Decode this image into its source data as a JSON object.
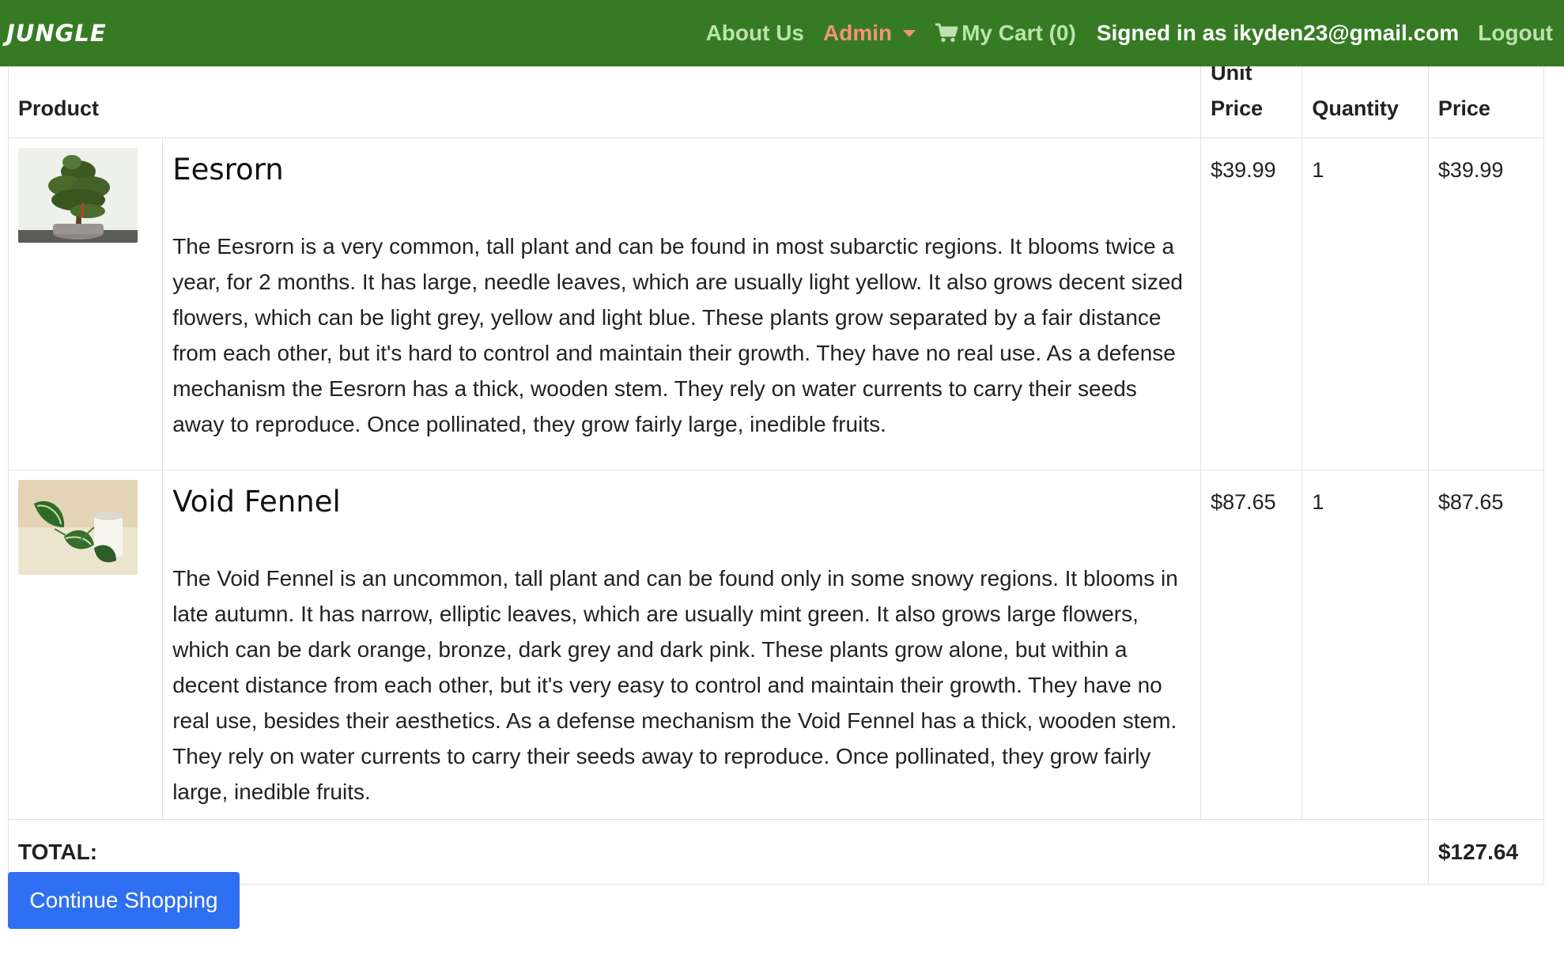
{
  "navbar": {
    "brand": "JUNGLE",
    "about": "About Us",
    "admin": "Admin",
    "cart": "My Cart (0)",
    "signed_in": "Signed in as ikyden23@gmail.com",
    "logout": "Logout",
    "colors": {
      "bg": "#367b24",
      "link": "#bde2ad",
      "admin": "#f59279"
    }
  },
  "table": {
    "headers": {
      "product": "Product",
      "unit_price": "Unit Price",
      "unit_price_top": "Unit",
      "unit_price_bottom": "Price",
      "quantity": "Quantity",
      "price": "Price"
    },
    "rows": [
      {
        "name": "Eesrorn",
        "image": "bonsai-tree",
        "description": "The Eesrorn is a very common, tall plant and can be found in most subarctic regions. It blooms twice a year, for 2 months. It has large, needle leaves, which are usually light yellow. It also grows decent sized flowers, which can be light grey, yellow and light blue. These plants grow separated by a fair distance from each other, but it's hard to control and maintain their growth. They have no real use. As a defense mechanism the Eesrorn has a thick, wooden stem. They rely on water currents to carry their seeds away to reproduce. Once pollinated, they grow fairly large, inedible fruits.",
        "unit_price": "$39.99",
        "quantity": "1",
        "price": "$39.99"
      },
      {
        "name": "Void Fennel",
        "image": "potted-plant",
        "description": "The Void Fennel is an uncommon, tall plant and can be found only in some snowy regions. It blooms in late autumn. It has narrow, elliptic leaves, which are usually mint green. It also grows large flowers, which can be dark orange, bronze, dark grey and dark pink. These plants grow alone, but within a decent distance from each other, but it's very easy to control and maintain their growth. They have no real use, besides their aesthetics. As a defense mechanism the Void Fennel has a thick, wooden stem. They rely on water currents to carry their seeds away to reproduce. Once pollinated, they grow fairly large, inedible fruits.",
        "unit_price": "$87.65",
        "quantity": "1",
        "price": "$87.65"
      }
    ],
    "total_label": "TOTAL:",
    "total_value": "$127.64"
  },
  "actions": {
    "continue": "Continue Shopping",
    "continue_color": "#2f6ff2"
  }
}
